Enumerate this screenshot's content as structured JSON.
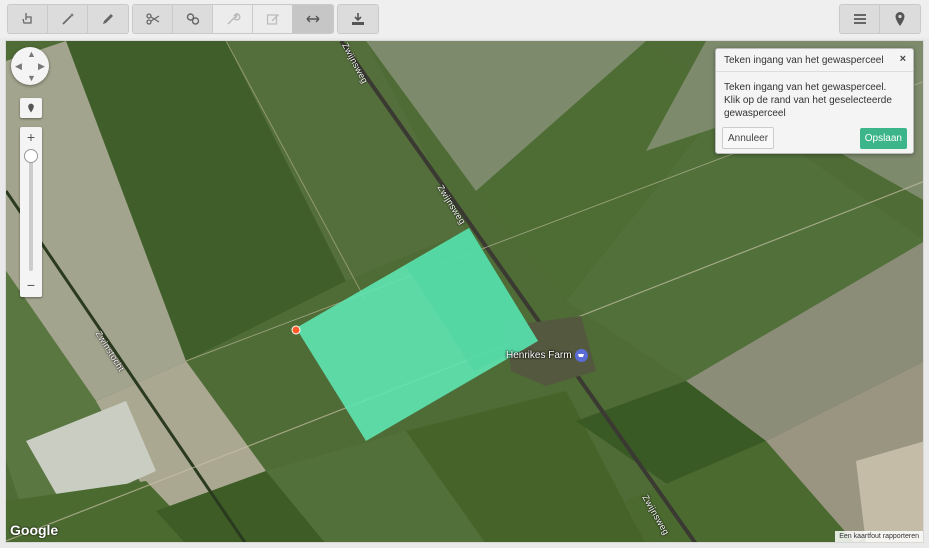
{
  "toolbar": {
    "group1": [
      {
        "icon": "hand-pointer-icon",
        "state": "normal"
      },
      {
        "icon": "magic-wand-icon",
        "state": "normal"
      },
      {
        "icon": "pencil-icon",
        "state": "normal"
      }
    ],
    "group2": [
      {
        "icon": "scissors-icon",
        "state": "normal"
      },
      {
        "icon": "link-icon",
        "state": "normal"
      },
      {
        "icon": "wrench-icon",
        "state": "disabled"
      },
      {
        "icon": "edit-icon",
        "state": "disabled"
      },
      {
        "icon": "horizontal-arrows-icon",
        "state": "active"
      }
    ],
    "group3": [
      {
        "icon": "download-icon",
        "state": "normal"
      }
    ],
    "right": [
      {
        "icon": "menu-icon",
        "state": "normal"
      },
      {
        "icon": "map-marker-icon",
        "state": "normal"
      }
    ]
  },
  "map": {
    "roads": {
      "zwijnsweg_top": "Zwijnsweg",
      "zwijnsweg_mid": "Zwijnsweg",
      "zwijnsweg_bottom": "Zwijnsweg",
      "zwinstocht": "Zwinstocht"
    },
    "poi": {
      "label": "Henrikes Farm",
      "icon": "shopping-cart-icon"
    },
    "attribution": "Google",
    "report_link": "Een kaartfout rapporteren",
    "selected_field_color": "#5ee6b2",
    "entrance_point_color": "#ff5a2a"
  },
  "controls": {
    "zoom_in": "+",
    "zoom_out": "−"
  },
  "popup": {
    "title": "Teken ingang van het gewasperceel",
    "close": "×",
    "body": "Teken ingang van het gewasperceel. Klik op de rand van het geselecteerde gewasperceel",
    "cancel": "Annuleer",
    "save": "Opslaan"
  },
  "colors": {
    "accent": "#3cb58b",
    "toolbar_bg": "#dcdcdc"
  }
}
